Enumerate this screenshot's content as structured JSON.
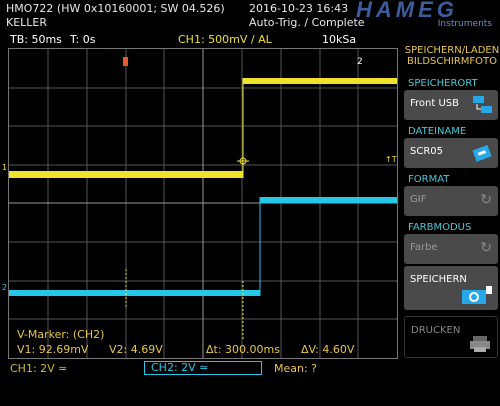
{
  "header": {
    "model_line": "HMO722 (HW 0x10160001; SW 04.526)",
    "user": "KELLER",
    "datetime": "2016-10-23 16:43",
    "trigger_state": "Auto-Trig. / Complete",
    "brand": "HAMEG",
    "brand_sub": "Instruments"
  },
  "status": {
    "timebase": "TB: 50ms",
    "trigger_time": "T: 0s",
    "ch1_trigger": "CH1: 500mV / AL",
    "samplerate": "10kSa"
  },
  "markers": {
    "trigger_marker_1": "1",
    "trigger_marker_2": "2",
    "level_marker": "↑T",
    "ch1_ref": "1",
    "ch2_ref": "2"
  },
  "measure": {
    "title": "V-Marker: (CH2)",
    "v1": "V1: 92.69mV",
    "v2": "V2: 4.69V",
    "dt": "Δt: 300.00ms",
    "dv": "ΔV: 4.60V"
  },
  "bottom": {
    "ch1": "CH1: 2V ≃",
    "ch2": "CH2: 2V ≃",
    "mean": "Mean: ?"
  },
  "menu": {
    "title_line1": "SPEICHERN/LADEN",
    "title_line2": "BILDSCHIRMFOTO",
    "speicherort_label": "SPEICHERORT",
    "speicherort_value": "Front USB",
    "dateiname_label": "DATEINAME",
    "dateiname_value": "SCR05",
    "format_label": "FORMAT",
    "format_value": "GIF",
    "farbmodus_label": "FARBMODUS",
    "farbmodus_value": "Farbe",
    "save_label": "SPEICHERN",
    "print_label": "DRUCKEN"
  },
  "colors": {
    "ch1": "#f0e22a",
    "ch2": "#26c6e8",
    "menu_accent": "#47c8d8",
    "title": "#e8c64a"
  }
}
